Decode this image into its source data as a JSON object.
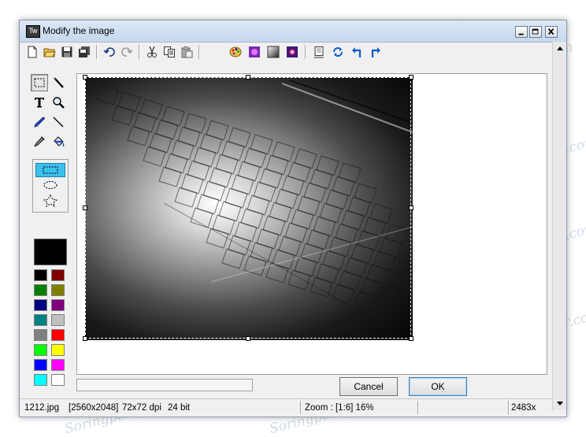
{
  "window": {
    "title": "Modify the image",
    "app_icon_text": "Tw"
  },
  "toolbar": {
    "buttons": [
      {
        "name": "new-icon"
      },
      {
        "name": "open-folder-icon"
      },
      {
        "name": "save-icon"
      },
      {
        "name": "save-all-icon"
      },
      {
        "name": "undo-icon"
      },
      {
        "name": "redo-icon"
      },
      {
        "name": "cut-icon"
      },
      {
        "name": "copy-icon"
      },
      {
        "name": "paste-icon"
      },
      {
        "name": "palette-icon"
      },
      {
        "name": "effects-icon"
      },
      {
        "name": "grayscale-icon"
      },
      {
        "name": "colorize-icon"
      },
      {
        "name": "resize-icon"
      },
      {
        "name": "rotate-icon"
      },
      {
        "name": "rotate-left-icon"
      },
      {
        "name": "rotate-right-icon"
      }
    ]
  },
  "tools": [
    "rect-select-icon",
    "pencil-thin-icon",
    "text-icon",
    "zoom-icon",
    "pencil-icon",
    "line-icon",
    "eyedropper-icon",
    "fill-bucket-icon"
  ],
  "shape_options": [
    "rectangle",
    "ellipse",
    "freeform"
  ],
  "palette": {
    "current": "#000000",
    "swatches": [
      "#000000",
      "#800000",
      "#008000",
      "#808000",
      "#000080",
      "#800080",
      "#008080",
      "#c0c0c0",
      "#808080",
      "#ff0000",
      "#00ff00",
      "#ffff00",
      "#0000ff",
      "#ff00ff",
      "#00ffff",
      "#ffffff"
    ]
  },
  "buttons": {
    "cancel": "Cancel",
    "ok": "OK"
  },
  "status": {
    "filename": "1212.jpg",
    "dimensions": "[2560x2048]",
    "dpi": "72x72 dpi",
    "depth": "24 bit",
    "zoom": "Zoom : [1:6] 16%",
    "extra": "2483x"
  },
  "watermark": "Soringpcrepair.com",
  "colors": {
    "accent": "#3ac0ec",
    "title_bar": "#c6d8ee"
  }
}
